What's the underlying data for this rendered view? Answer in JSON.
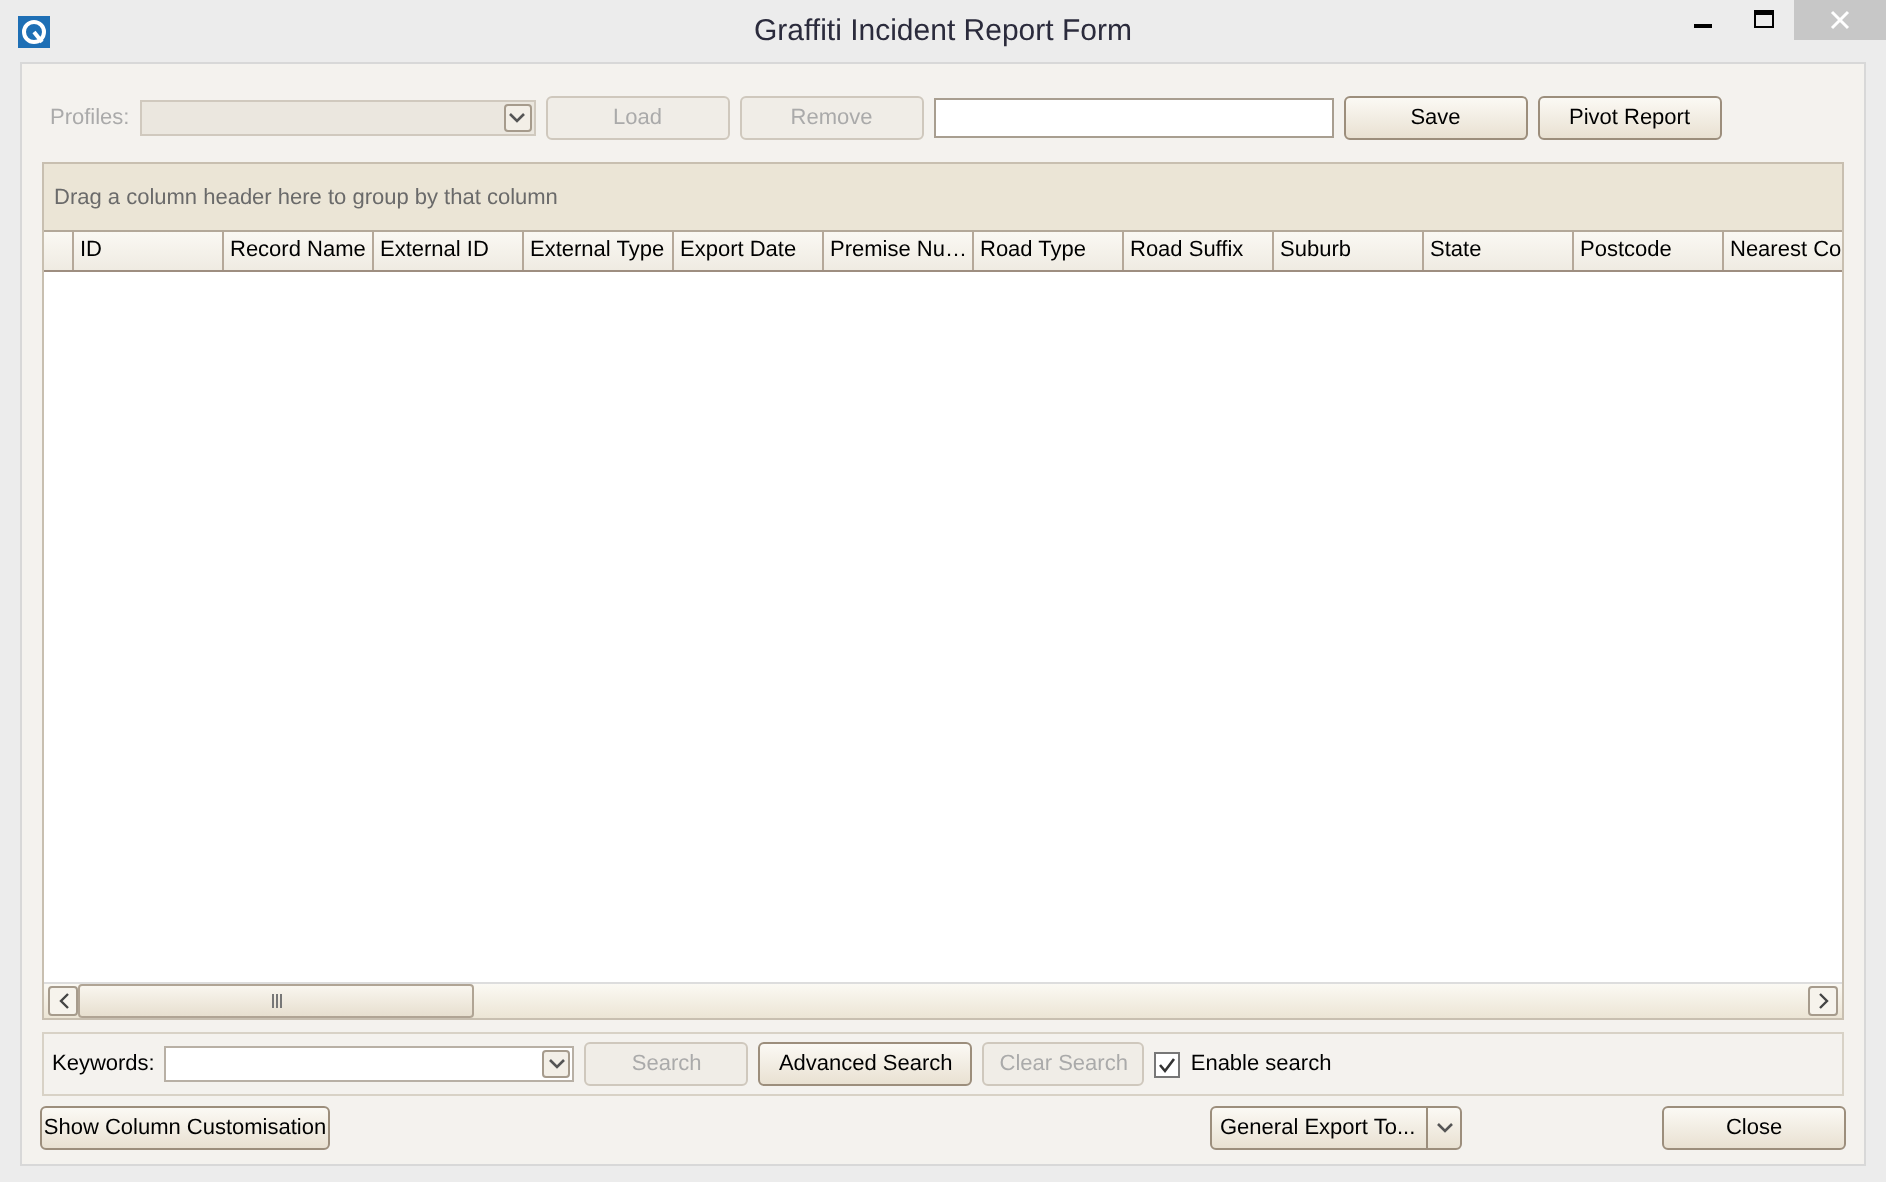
{
  "window": {
    "title": "Graffiti Incident Report Form"
  },
  "toolbar": {
    "profiles_label": "Profiles:",
    "profiles_disabled": true,
    "items": [
      {
        "kind": "button",
        "label": "Load",
        "disabled": true
      },
      {
        "kind": "button",
        "label": "Remove",
        "disabled": true
      },
      {
        "kind": "field"
      },
      {
        "kind": "button",
        "label": "Save",
        "disabled": false
      },
      {
        "kind": "button",
        "label": "Pivot Report",
        "disabled": false
      }
    ]
  },
  "grid": {
    "group_hint": "Drag a column header here to group by that column",
    "columns": [
      "ID",
      "Record Name",
      "External ID",
      "External Type",
      "Export Date",
      "Premise Nu…",
      "Road Type",
      "Road Suffix",
      "Suburb",
      "State",
      "Postcode",
      "Nearest Co"
    ]
  },
  "search_bar": {
    "keywords_label": "Keywords:",
    "buttons": [
      {
        "label": "Search",
        "disabled": true
      },
      {
        "label": "Advanced Search",
        "disabled": false
      },
      {
        "label": "Clear Search",
        "disabled": true
      }
    ],
    "enable_search": {
      "label": "Enable search",
      "checked": true
    }
  },
  "footer": [
    {
      "kind": "button",
      "label": "Show Column Customisation"
    },
    {
      "kind": "split",
      "label": "General Export To..."
    },
    {
      "kind": "button",
      "label": "Close"
    }
  ]
}
